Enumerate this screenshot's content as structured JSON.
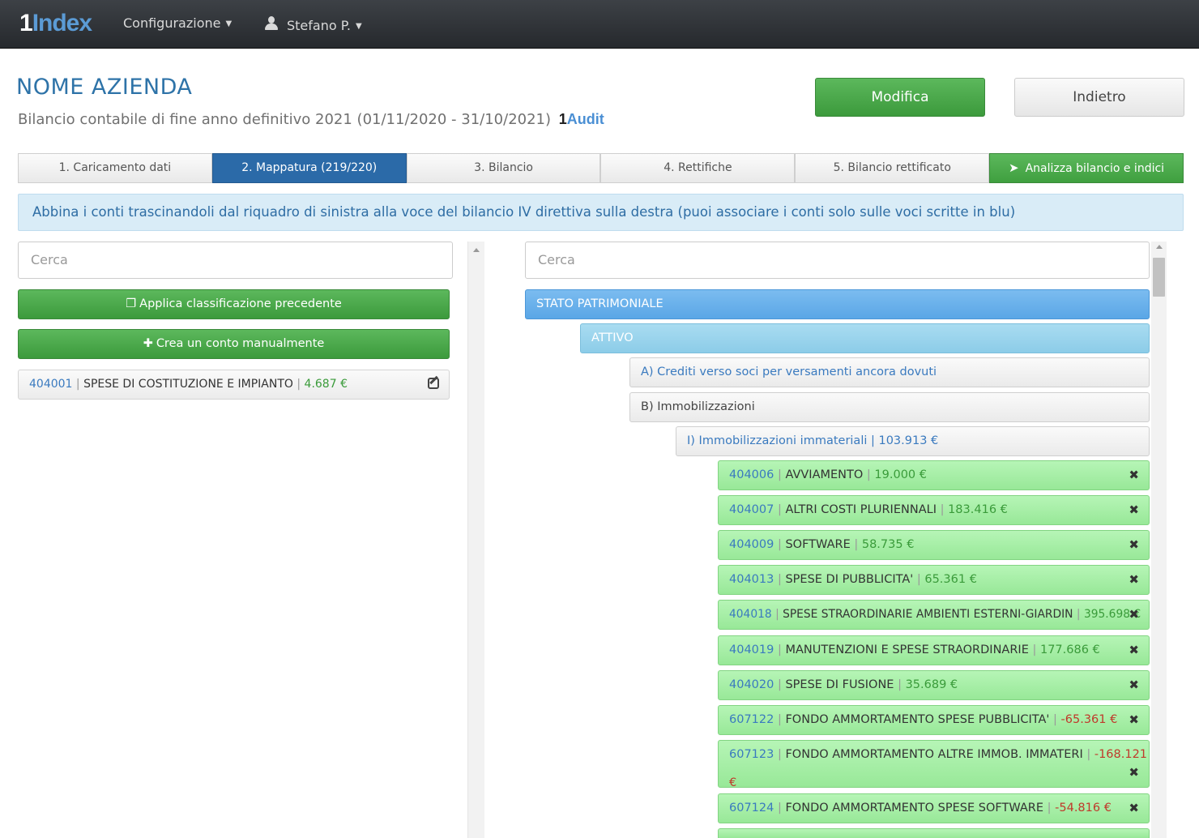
{
  "navbar": {
    "logo_one": "1",
    "logo_rest": "Index",
    "config_label": "Configurazione",
    "user_label": "Stefano P."
  },
  "header": {
    "company": "NOME AZIENDA",
    "subtitle": "Bilancio contabile di fine anno definitivo 2021 (01/11/2020 - 31/10/2021)",
    "brand_one": "1",
    "brand_rest": "Audit",
    "modifica": "Modifica",
    "indietro": "Indietro"
  },
  "tabs": [
    "1. Caricamento dati",
    "2. Mappatura (219/220)",
    "3. Bilancio",
    "4. Rettifiche",
    "5. Bilancio rettificato",
    "Analizza bilancio e indici"
  ],
  "info": "Abbina i conti trascinandoli dal riquadro di sinistra alla voce del bilancio IV direttiva sulla destra (puoi associare i conti solo sulle voci scritte in blu)",
  "left": {
    "search_placeholder": "Cerca",
    "apply_button": "Applica classificazione precedente",
    "create_button": "Crea un conto manualmente",
    "account": {
      "code": "404001",
      "name": "SPESE DI COSTITUZIONE E IMPIANTO",
      "amount": "4.687 €"
    }
  },
  "right": {
    "search_placeholder": "Cerca",
    "stato": "STATO PATRIMONIALE",
    "attivo": "ATTIVO",
    "a_crediti": "A) Crediti verso soci per versamenti ancora dovuti",
    "b_immob": "B) Immobilizzazioni",
    "i_immat": "I) Immobilizzazioni immateriali | 103.913 €",
    "accounts": [
      {
        "code": "404006",
        "name": "AVVIAMENTO",
        "amount": "19.000 €"
      },
      {
        "code": "404007",
        "name": "ALTRI COSTI PLURIENNALI",
        "amount": "183.416 €"
      },
      {
        "code": "404009",
        "name": "SOFTWARE",
        "amount": "58.735 €"
      },
      {
        "code": "404013",
        "name": "SPESE DI PUBBLICITA'",
        "amount": "65.361 €"
      },
      {
        "code": "404018",
        "name": "SPESE STRAORDINARIE AMBIENTI ESTERNI-GIARDIN",
        "amount": "395.698 €"
      },
      {
        "code": "404019",
        "name": "MANUTENZIONI E SPESE STRAORDINARIE",
        "amount": "177.686 €"
      },
      {
        "code": "404020",
        "name": "SPESE DI FUSIONE",
        "amount": "35.689 €"
      },
      {
        "code": "607122",
        "name": "FONDO AMMORTAMENTO SPESE PUBBLICITA'",
        "amount": "-65.361 €"
      },
      {
        "code": "607123",
        "name": "FONDO AMMORTAMENTO ALTRE IMMOB. IMMATERI",
        "amount": "-168.121 €"
      },
      {
        "code": "607124",
        "name": "FONDO AMMORTAMENTO SPESE SOFTWARE",
        "amount": "-54.816 €"
      }
    ]
  },
  "colors": {
    "navbar": "#2e3135",
    "primary_blue": "#2b6aa8",
    "green": "#4cae4c",
    "account_green": "#a8eda8",
    "link_blue": "#3a7abf",
    "negative_red": "#c0392b"
  }
}
